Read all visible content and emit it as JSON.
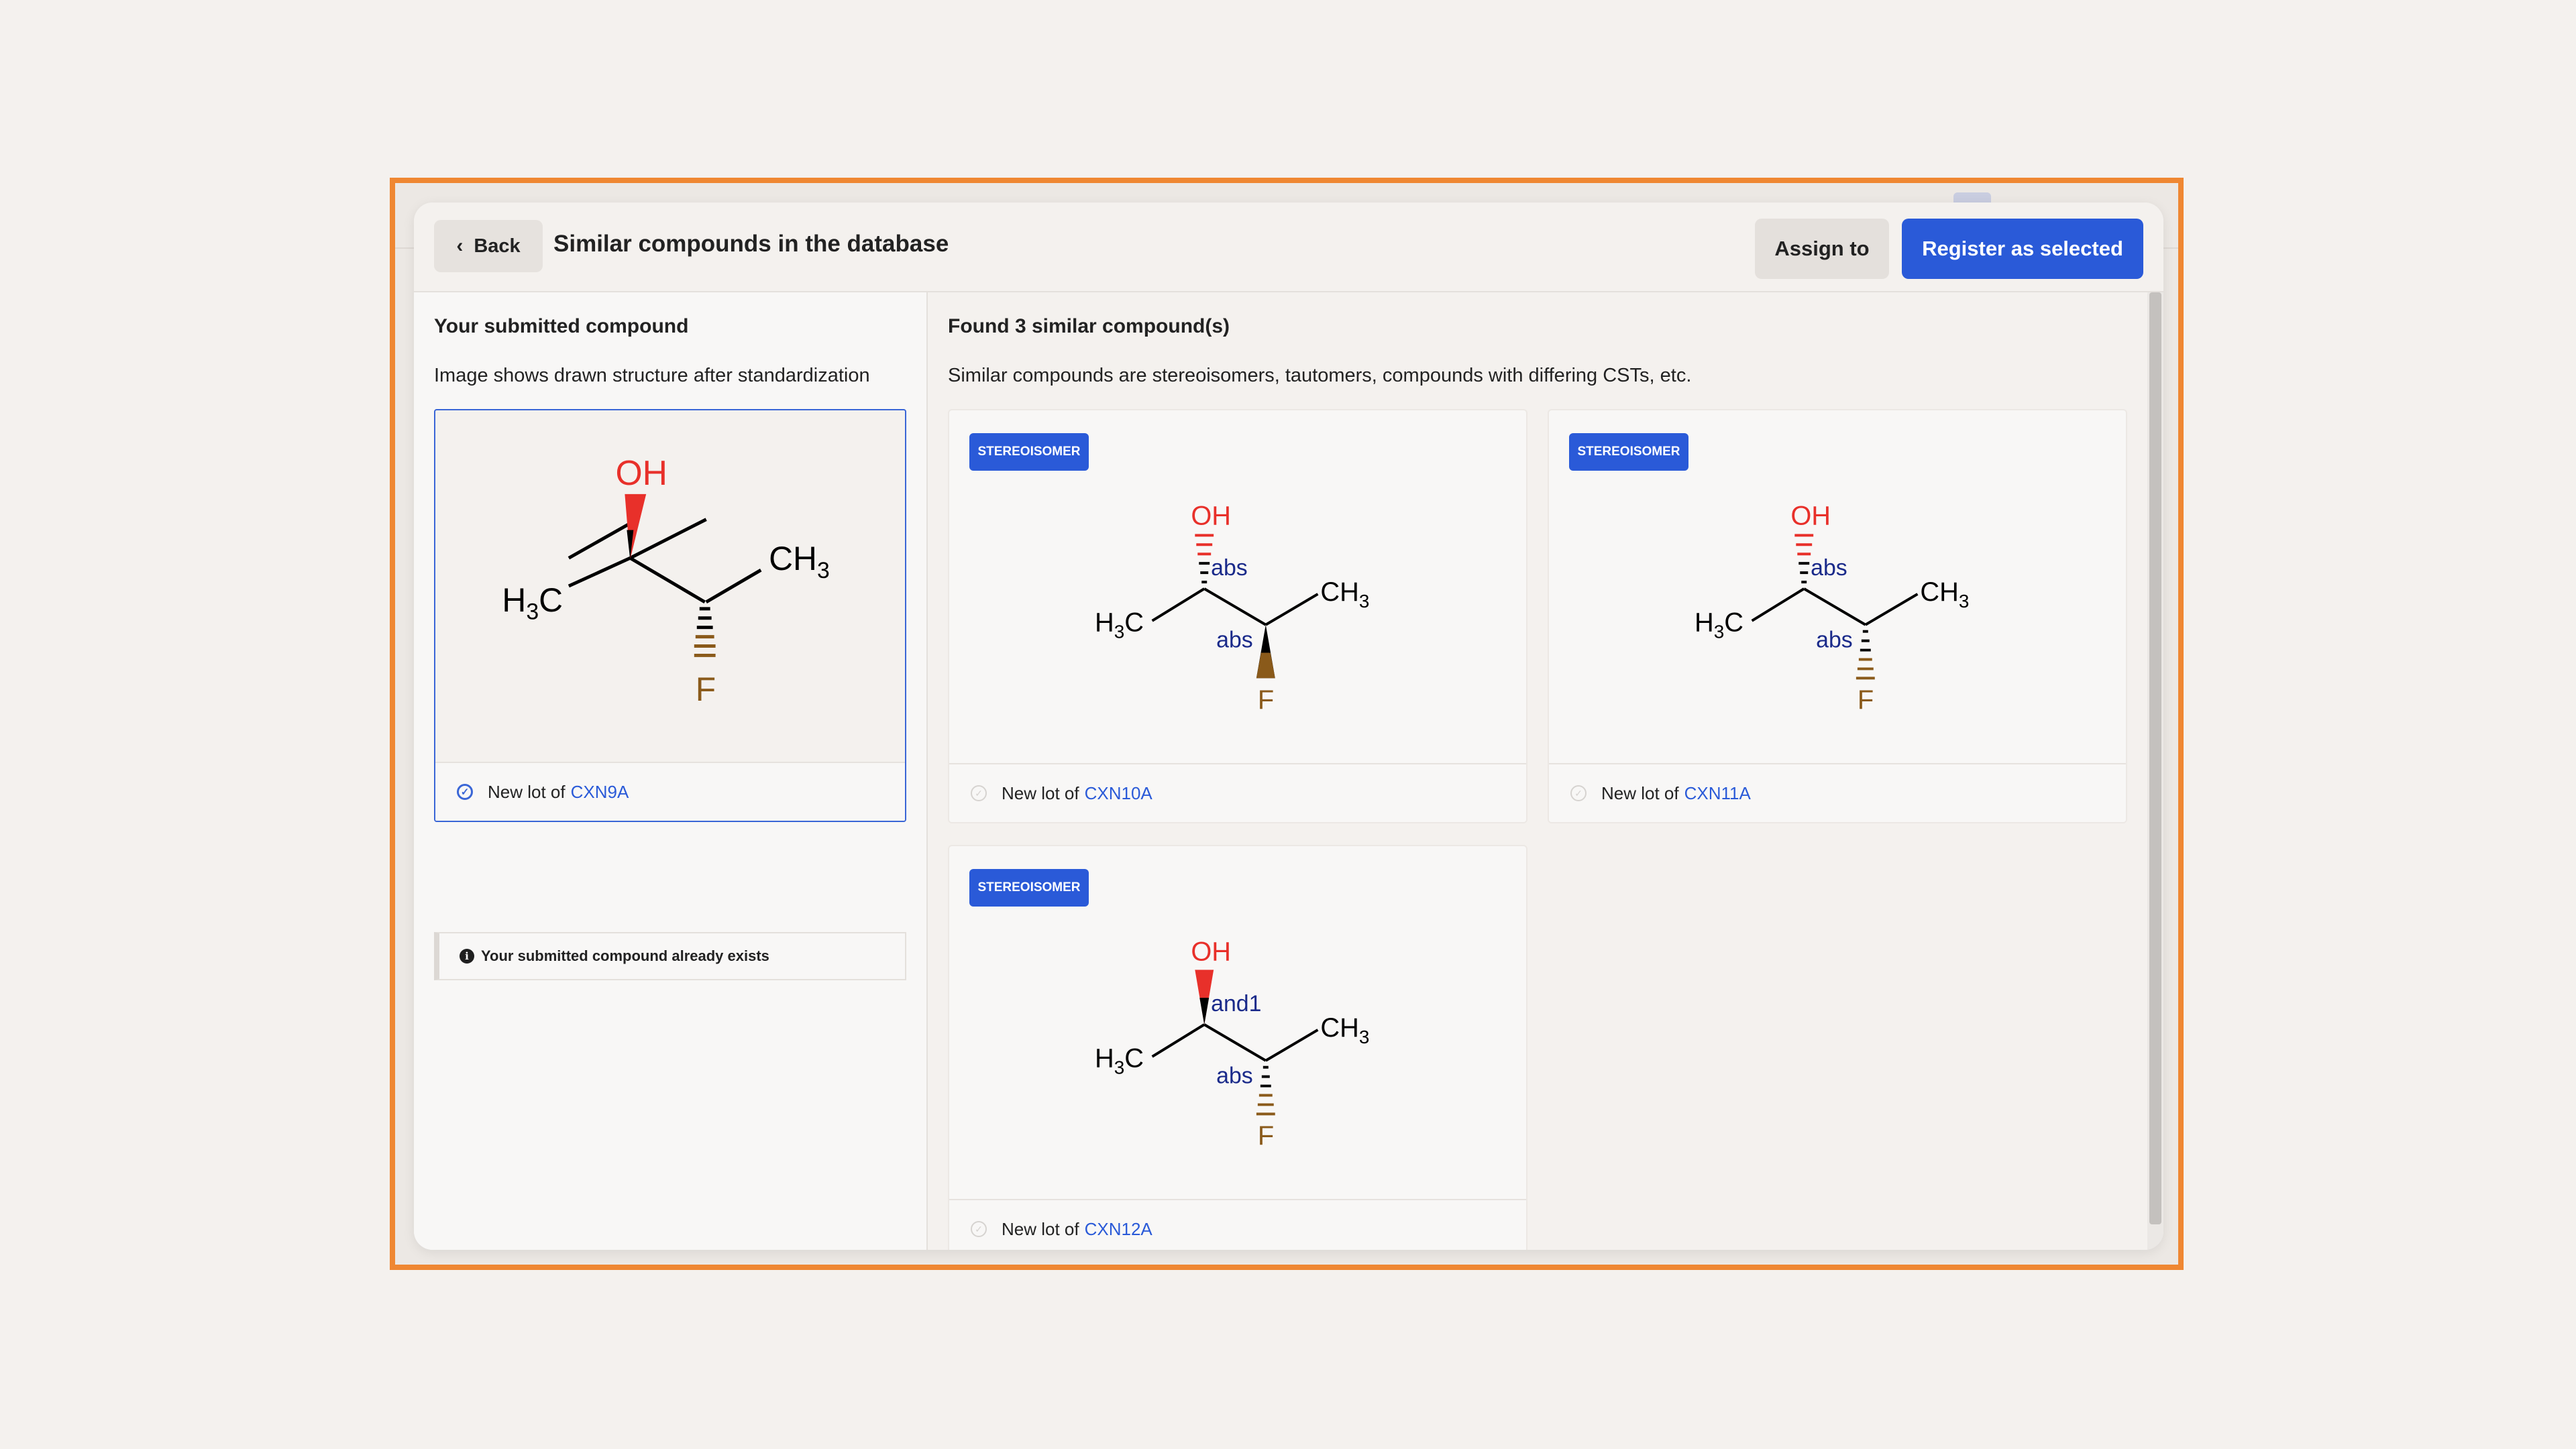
{
  "header": {
    "back_label": "Back",
    "title": "Similar compounds in the database",
    "assign_label": "Assign to",
    "register_label": "Register as selected"
  },
  "submitted": {
    "title": "Your submitted compound",
    "subtitle": "Image shows drawn structure after standardization",
    "lot_prefix": "New lot of",
    "lot_id": "CXN9A",
    "selected": true,
    "notice": "Your submitted compound already exists",
    "structure": {
      "oh": "OH",
      "ch3": "CH",
      "ch3_sub": "3",
      "h3c_h": "H",
      "h3c_sub": "3",
      "h3c_c": "C",
      "f": "F"
    }
  },
  "results": {
    "title": "Found 3 similar compound(s)",
    "subtitle": "Similar compounds are stereoisomers, tautomers, compounds with differing CSTs, etc.",
    "cards": [
      {
        "tag": "STEREOISOMER",
        "lot_prefix": "New lot of",
        "lot_id": "CXN10A",
        "label_top": "abs",
        "label_bottom": "abs"
      },
      {
        "tag": "STEREOISOMER",
        "lot_prefix": "New lot of",
        "lot_id": "CXN11A",
        "label_top": "abs",
        "label_bottom": "abs"
      },
      {
        "tag": "STEREOISOMER",
        "lot_prefix": "New lot of",
        "lot_id": "CXN12A",
        "label_top": "and1",
        "label_bottom": "abs"
      }
    ]
  },
  "colors": {
    "accent": "#2a5ad8",
    "highlight_frame": "#ef8732",
    "oxygen": "#e8302a",
    "fluorine": "#8a5a1a",
    "stereo_label": "#1a2a8a"
  }
}
